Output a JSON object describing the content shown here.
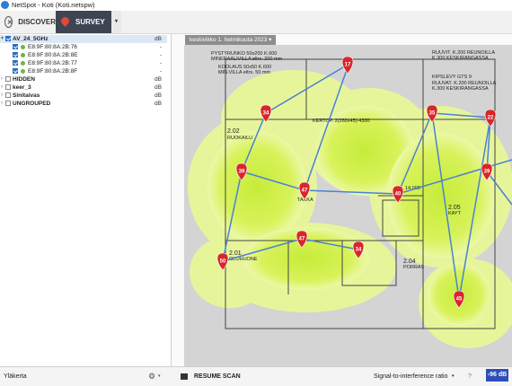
{
  "window": {
    "title": "NetSpot - Koti (Koti.netspw)"
  },
  "toolbar": {
    "discover_label": "DISCOVER",
    "survey_label": "SURVEY"
  },
  "sidebar": {
    "rows": [
      {
        "label": "AV_24_5GHz",
        "value": "dB",
        "selected": true
      },
      {
        "label": "E8:9F:80:8A:2B:76",
        "value": "-"
      },
      {
        "label": "E8:9F:80:8A:2B:8E",
        "value": "-"
      },
      {
        "label": "E8:9F:80:8A:2B:77",
        "value": "-"
      },
      {
        "label": "E8:9F:80:8A:2B:8F",
        "value": "-"
      },
      {
        "label": "HIDDEN",
        "value": "dB"
      },
      {
        "label": "keer_3",
        "value": "dB"
      },
      {
        "label": "Sinitaivas",
        "value": "dB"
      },
      {
        "label": "UNGROUPED",
        "value": "dB"
      }
    ]
  },
  "map": {
    "tab_label": "keskivikko 1. helmikuuta 2023",
    "points": [
      17,
      34,
      35,
      22,
      39,
      47,
      40,
      39,
      47,
      34,
      50,
      45
    ],
    "texts": {
      "t1": "PYSTYRUNKO 50x200 K.600",
      "t2": "MINERAALIVILLA eltrx. 200 mm",
      "t3": "KOOLAUS 50x50 K.600",
      "t4": "MIN.VILLA eltrx. 50 mm",
      "t5": "RUUVIT. K.200 REUNOILLA",
      "t6": "K.300 KESKIRANGASSA",
      "t7": "KIPSLEVY GTS 9",
      "t8": "RUUVAT. K.200 REUNOILLA",
      "t9": "K.300 KESKIRANGASSA",
      "t10": "KERTOP. 2(260x45)-4300",
      "r1": "2.02",
      "r1b": "RUOKAILU",
      "r2": "2.05",
      "r2b": "KAYT",
      "r3": "2.01",
      "r3b": "OLOHUONE",
      "r4": "2.04",
      "r4b": "PORRAS",
      "r5": "TAKKA",
      "r6": "14,000"
    }
  },
  "bottom": {
    "floor_label": "Yläkerta",
    "resume_label": "RESUME SCAN",
    "metric_label": "Signal-to-interference ratio",
    "level_badge": "-96 dB"
  }
}
